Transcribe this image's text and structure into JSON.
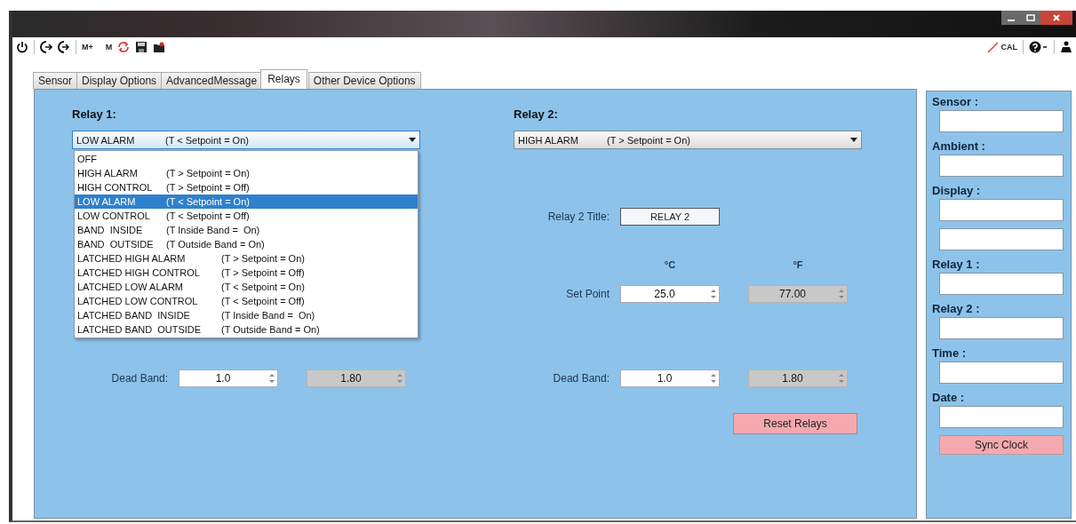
{
  "toolbar": {
    "memory_add": "M+",
    "memory": "M",
    "calibrate": "CAL"
  },
  "tabs": [
    {
      "label": "Sensor",
      "selected": false
    },
    {
      "label": "Display Options",
      "selected": false
    },
    {
      "label": "AdvancedMessage",
      "selected": false
    },
    {
      "label": "Relays",
      "selected": true
    },
    {
      "label": "Other Device Options",
      "selected": false
    }
  ],
  "relay_1": {
    "label": "Relay 1:",
    "value": "LOW ALARM",
    "value_condition": "(T < Setpoint = On)",
    "expanded": true,
    "options": [
      {
        "mode": "OFF",
        "selected": false
      },
      {
        "mode": "HIGH ALARM",
        "condition": "(T > Setpoint = On)",
        "selected": false
      },
      {
        "mode": "HIGH CONTROL",
        "condition": "(T > Setpoint = Off)",
        "selected": false
      },
      {
        "mode": "LOW ALARM",
        "condition": "(T < Setpoint = On)",
        "selected": true
      },
      {
        "mode": "LOW CONTROL",
        "condition": "(T < Setpoint = Off)",
        "selected": false
      },
      {
        "mode": "BAND  INSIDE",
        "condition": "(T Inside Band =  On)",
        "selected": false
      },
      {
        "mode": "BAND  OUTSIDE",
        "condition": "(T Outside Band = On)",
        "selected": false
      },
      {
        "mode": "LATCHED HIGH ALARM",
        "condition": "(T > Setpoint = On)",
        "selected": false
      },
      {
        "mode": "LATCHED HIGH CONTROL",
        "condition": "(T > Setpoint = Off)",
        "selected": false
      },
      {
        "mode": "LATCHED LOW ALARM",
        "condition": "(T < Setpoint = On)",
        "selected": false
      },
      {
        "mode": "LATCHED LOW CONTROL",
        "condition": "(T < Setpoint = Off)",
        "selected": false
      },
      {
        "mode": "LATCHED BAND  INSIDE",
        "condition": "(T Inside Band =  On)",
        "selected": false
      },
      {
        "mode": "LATCHED BAND  OUTSIDE",
        "condition": "(T Outside Band = On)",
        "selected": false
      }
    ],
    "dead_band": {
      "label": "Dead Band:",
      "celsius": {
        "value": "1.0",
        "disabled": false
      },
      "fahrenheit": {
        "value": "1.80",
        "disabled": true
      }
    }
  },
  "relay_2": {
    "label": "Relay 2:",
    "value": "HIGH ALARM",
    "value_condition": "(T > Setpoint = On)",
    "expanded": false,
    "title_label": "Relay 2 Title:",
    "title_value": "RELAY 2",
    "unit_c": "°C",
    "unit_f": "°F",
    "set_point": {
      "label": "Set Point",
      "celsius": {
        "value": "25.0",
        "disabled": false
      },
      "fahrenheit": {
        "value": "77.00",
        "disabled": true
      }
    },
    "dead_band": {
      "label": "Dead Band:",
      "celsius": {
        "value": "1.0",
        "disabled": false
      },
      "fahrenheit": {
        "value": "1.80",
        "disabled": true
      }
    },
    "reset_button": "Reset Relays"
  },
  "sidebar": {
    "rows": [
      {
        "kind": "labeled",
        "label": "Sensor :"
      },
      {
        "kind": "labeled",
        "label": "Ambient :"
      },
      {
        "kind": "labeled",
        "label": "Display :"
      },
      {
        "kind": "field"
      },
      {
        "kind": "labeled",
        "label": "Relay 1 :"
      },
      {
        "kind": "labeled",
        "label": "Relay 2 :"
      },
      {
        "kind": "labeled",
        "label": "Time :"
      },
      {
        "kind": "labeled",
        "label": "Date :"
      }
    ],
    "sync_button": "Sync Clock"
  }
}
